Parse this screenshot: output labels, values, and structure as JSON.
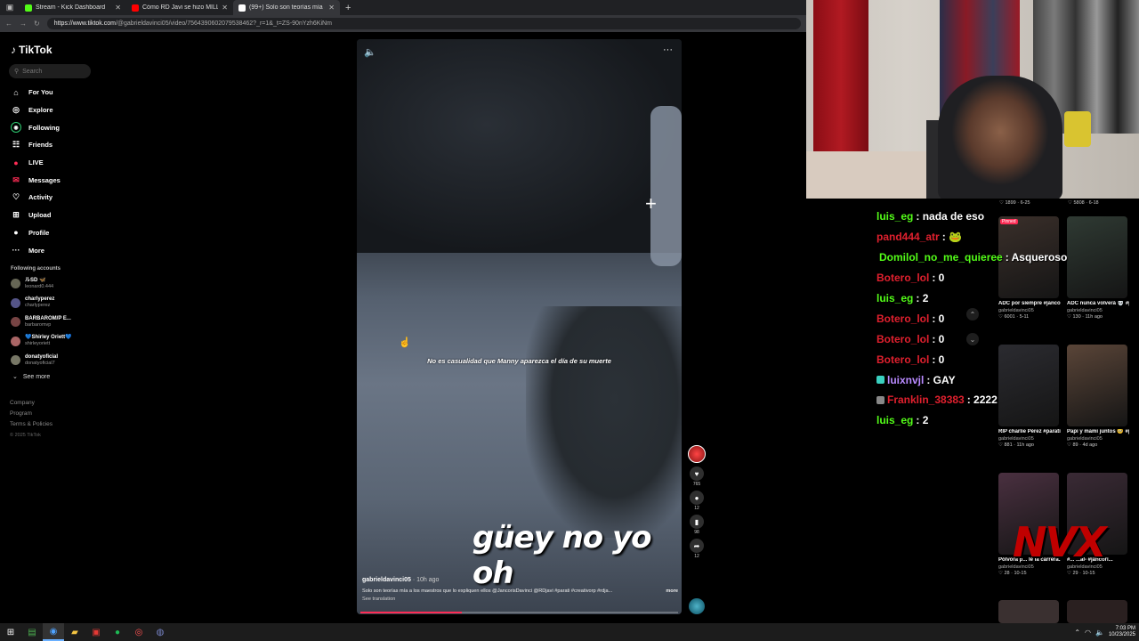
{
  "browser": {
    "tabs": [
      {
        "title": "Stream - Kick Dashboard",
        "color": "#53fc18"
      },
      {
        "title": "Cómo RD Javi se hizo MILLONARI",
        "color": "#ff0000"
      },
      {
        "title": "(99+) Solo son teorías mía a",
        "color": "#ffffff"
      }
    ],
    "url_host": "https://www.tiktok.com",
    "url_path": "/@gabrieldavinci05/video/7564390602079538462?_r=1&_t=ZS-90nYzh6KiNm"
  },
  "tiktok": {
    "brand": "TikTok",
    "search_placeholder": "Search",
    "nav": [
      {
        "label": "For You",
        "icon": "home-icon",
        "glyph": "⌂"
      },
      {
        "label": "Explore",
        "icon": "compass-icon",
        "glyph": "◎"
      },
      {
        "label": "Following",
        "icon": "following-icon",
        "glyph": "◉"
      },
      {
        "label": "Friends",
        "icon": "friends-icon",
        "glyph": "☷"
      },
      {
        "label": "LIVE",
        "icon": "live-icon",
        "glyph": "●"
      },
      {
        "label": "Messages",
        "icon": "messages-icon",
        "glyph": "✉"
      },
      {
        "label": "Activity",
        "icon": "activity-icon",
        "glyph": "♡"
      },
      {
        "label": "Upload",
        "icon": "upload-icon",
        "glyph": "⊞"
      },
      {
        "label": "Profile",
        "icon": "profile-icon",
        "glyph": "●"
      },
      {
        "label": "More",
        "icon": "more-icon",
        "glyph": "···"
      }
    ],
    "following_title": "Following accounts",
    "accounts": [
      {
        "name": "ルSD 🦋",
        "handle": "leonard0.444"
      },
      {
        "name": "charlyperez",
        "handle": "charlyperez"
      },
      {
        "name": "BARBAROM/P E...",
        "handle": "barbaromvp"
      },
      {
        "name": "💙Shirley Oriett💙",
        "handle": "shirleyoriett"
      },
      {
        "name": "donatyoficial",
        "handle": "donatyoficial7"
      }
    ],
    "see_more": "See more",
    "footer": [
      "Company",
      "Program",
      "Terms & Policies"
    ],
    "copyright": "© 2025 TikTok"
  },
  "video": {
    "caption_small": "No es casualidad que Manny aparezca el día de su muerte",
    "caption_big": "güey no yo oh",
    "author": "gabrieldavinci05",
    "time_ago": "· 10h ago",
    "description": "Solo son teorías mía a los maestros que lo expliquen ellos @JancorisDavinci @RDjavi #parati #creativorp #rdja...",
    "more_label": "more",
    "see_translation": "See translation",
    "progress": 0.32,
    "actions": [
      {
        "name": "like",
        "glyph": "♥",
        "count": "765"
      },
      {
        "name": "comment",
        "glyph": "●",
        "count": "12"
      },
      {
        "name": "bookmark",
        "glyph": "▮",
        "count": "98"
      },
      {
        "name": "share",
        "glyph": "➦",
        "count": "12"
      }
    ]
  },
  "chat": [
    {
      "user": "luis_eg",
      "text": ": nada de eso",
      "color": "#53fc18",
      "badge": ""
    },
    {
      "user": "pand444_atr",
      "text": ": 🐸",
      "color": "#e0202e",
      "badge": ""
    },
    {
      "user": "Domilol_no_me_quieree",
      "text": ": Asqueroso",
      "color": "#53fc18",
      "badge": "#3aa0e0"
    },
    {
      "user": "Botero_lol",
      "text": ": 0",
      "color": "#e0202e",
      "badge": ""
    },
    {
      "user": "luis_eg",
      "text": ": 2",
      "color": "#53fc18",
      "badge": ""
    },
    {
      "user": "Botero_lol",
      "text": ": 0",
      "color": "#e0202e",
      "badge": ""
    },
    {
      "user": "Botero_lol",
      "text": ": 0",
      "color": "#e0202e",
      "badge": ""
    },
    {
      "user": "Botero_lol",
      "text": ": 0",
      "color": "#e0202e",
      "badge": ""
    },
    {
      "user": "luixnvjl",
      "text": ": GAY",
      "color": "#b98aff",
      "badge": "#3ad0c0"
    },
    {
      "user": "Franklin_38383",
      "text": ": 2222",
      "color": "#e0202e",
      "badge": "#888888"
    },
    {
      "user": "luis_eg",
      "text": ": 2",
      "color": "#53fc18",
      "badge": ""
    }
  ],
  "related": {
    "top_stats": [
      "♡ 1899 · 6-25",
      "♡ 5808 · 6-18"
    ],
    "cards": [
      {
        "title": "ADC por siempre #jancorisdavinci...",
        "author": "gabrieldavinci05",
        "stats": "♡ 6001 · 5-11",
        "pinned": "Pinned"
      },
      {
        "title": "ADC nunca volverá 💀 #parati...",
        "author": "gabrieldavinci05",
        "stats": "♡ 130 · 11h ago",
        "pinned": ""
      },
      {
        "title": "RIP charlie Pérez #parati...",
        "author": "gabrieldavinci05",
        "stats": "♡ 881 · 11h ago",
        "pinned": ""
      },
      {
        "title": "Papi y mami juntos 🥺 #parat...",
        "author": "gabrieldavinci05",
        "stats": "♡ 89 · 4d ago",
        "pinned": ""
      },
      {
        "title": "Pólvora p... le la carrera...",
        "author": "gabrieldavinci05",
        "stats": "♡ 28 · 10-15",
        "pinned": ""
      },
      {
        "title": "#... ...al- #jancori...",
        "author": "gabrieldavinci05",
        "stats": "♡ 29 · 10-15",
        "pinned": ""
      }
    ]
  },
  "overlay_logo": "NVX",
  "taskbar": {
    "time": "7:03 PM",
    "date": "10/23/2025"
  }
}
